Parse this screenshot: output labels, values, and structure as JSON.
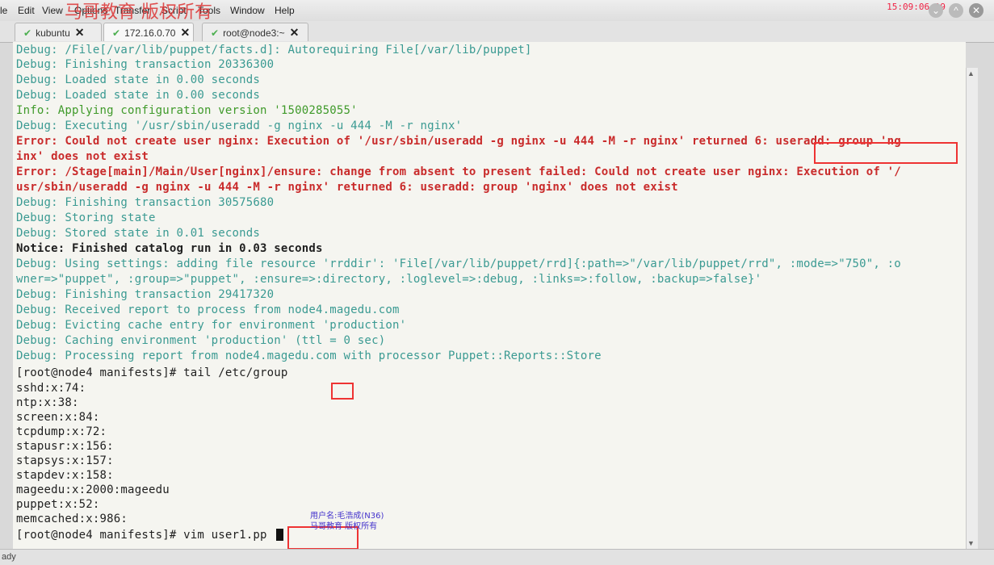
{
  "window": {
    "watermark": "马哥教育 版权所有",
    "clock": "15:09:06 19"
  },
  "menu": [
    "le",
    "Edit",
    "View",
    "Options",
    "Transfer",
    "Script",
    "Tools",
    "Window",
    "Help"
  ],
  "tabs": [
    {
      "label": "kubuntu",
      "active": false
    },
    {
      "label": "172.16.0.70",
      "active": true
    },
    {
      "label": "root@node3:~",
      "active": false
    }
  ],
  "terminal": {
    "lines": [
      {
        "text": "Debug: /File[/var/lib/puppet/facts.d]: Autorequiring File[/var/lib/puppet]",
        "type": "debug"
      },
      {
        "text": "Debug: Finishing transaction 20336300",
        "type": "debug"
      },
      {
        "text": "Debug: Loaded state in 0.00 seconds",
        "type": "debug"
      },
      {
        "text": "Debug: Loaded state in 0.00 seconds",
        "type": "debug"
      },
      {
        "text": "Info: Applying configuration version '1500285055'",
        "type": "info"
      },
      {
        "text": "Debug: Executing '/usr/sbin/useradd -g nginx -u 444 -M -r nginx'",
        "type": "debug"
      },
      {
        "text": "Error: Could not create user nginx: Execution of '/usr/sbin/useradd -g nginx -u 444 -M -r nginx' returned 6: useradd: group 'ng",
        "type": "error"
      },
      {
        "text": "inx' does not exist",
        "type": "error"
      },
      {
        "text": "Error: /Stage[main]/Main/User[nginx]/ensure: change from absent to present failed: Could not create user nginx: Execution of '/",
        "type": "error"
      },
      {
        "text": "usr/sbin/useradd -g nginx -u 444 -M -r nginx' returned 6: useradd: group 'nginx' does not exist",
        "type": "error"
      },
      {
        "text": "Debug: Finishing transaction 30575680",
        "type": "debug"
      },
      {
        "text": "Debug: Storing state",
        "type": "debug"
      },
      {
        "text": "Debug: Stored state in 0.01 seconds",
        "type": "debug"
      },
      {
        "text": "Notice: Finished catalog run in 0.03 seconds",
        "type": "notice"
      },
      {
        "text": "Debug: Using settings: adding file resource 'rrddir': 'File[/var/lib/puppet/rrd]{:path=>\"/var/lib/puppet/rrd\", :mode=>\"750\", :o",
        "type": "debug"
      },
      {
        "text": "wner=>\"puppet\", :group=>\"puppet\", :ensure=>:directory, :loglevel=>:debug, :links=>:follow, :backup=>false}'",
        "type": "debug"
      },
      {
        "text": "Debug: Finishing transaction 29417320",
        "type": "debug"
      },
      {
        "text": "Debug: Received report to process from node4.magedu.com",
        "type": "debug"
      },
      {
        "text": "Debug: Evicting cache entry for environment 'production'",
        "type": "debug"
      },
      {
        "text": "Debug: Caching environment 'production' (ttl = 0 sec)",
        "type": "debug"
      },
      {
        "text": "Debug: Processing report from node4.magedu.com with processor Puppet::Reports::Store",
        "type": "debug"
      },
      {
        "text": "[root@node4 manifests]# tail /etc/group",
        "type": "plain"
      },
      {
        "text": "sshd:x:74:",
        "type": "plain"
      },
      {
        "text": "ntp:x:38:",
        "type": "plain"
      },
      {
        "text": "screen:x:84:",
        "type": "plain"
      },
      {
        "text": "tcpdump:x:72:",
        "type": "plain"
      },
      {
        "text": "stapusr:x:156:",
        "type": "plain"
      },
      {
        "text": "stapsys:x:157:",
        "type": "plain"
      },
      {
        "text": "stapdev:x:158:",
        "type": "plain"
      },
      {
        "text": "mageedu:x:2000:mageedu",
        "type": "plain"
      },
      {
        "text": "puppet:x:52:",
        "type": "plain"
      },
      {
        "text": "memcached:x:986:",
        "type": "plain"
      },
      {
        "text": "[root@node4 manifests]# vim user1.pp ",
        "type": "plain"
      }
    ]
  },
  "overlay": {
    "line1": "用户名:毛浩成(N36)",
    "line2": "马哥教育 版权所有"
  },
  "status": {
    "text": "ady"
  },
  "colors": {
    "debug": "#3a9a92",
    "info": "#3f9a2a",
    "error": "#c92b2b",
    "annotation_box": "#e33333"
  }
}
